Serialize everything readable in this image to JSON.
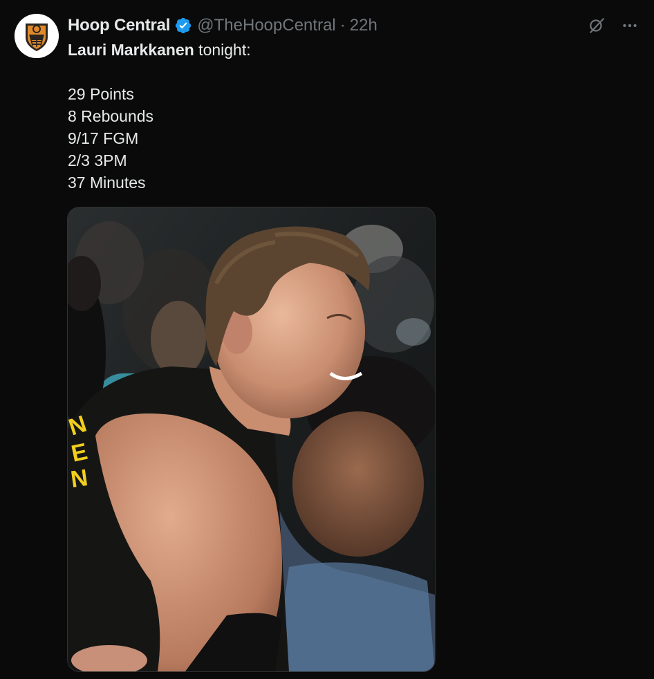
{
  "tweet": {
    "author": {
      "display_name": "Hoop Central",
      "handle": "@TheHoopCentral",
      "verified": true,
      "avatar_icon": "basketball-shield-logo-icon"
    },
    "separator": "·",
    "timestamp": "22h",
    "text": {
      "player_name": "Lauri Markkanen",
      "intro_suffix": " tonight:",
      "stats": [
        "29 Points",
        "8 Rebounds",
        "9/17 FGM",
        "2/3 3PM",
        "37 Minutes"
      ]
    },
    "actions": {
      "grok_icon": "grok-icon",
      "more_icon": "more-options-icon"
    },
    "media": {
      "type": "photo",
      "jersey_lettering": "NEN"
    }
  },
  "colors": {
    "background": "#0a0a0a",
    "primary_text": "#e7e9ea",
    "secondary_text": "#71767b",
    "verified_blue": "#1d9bf0",
    "jersey_yellow": "#f2cf1d"
  }
}
